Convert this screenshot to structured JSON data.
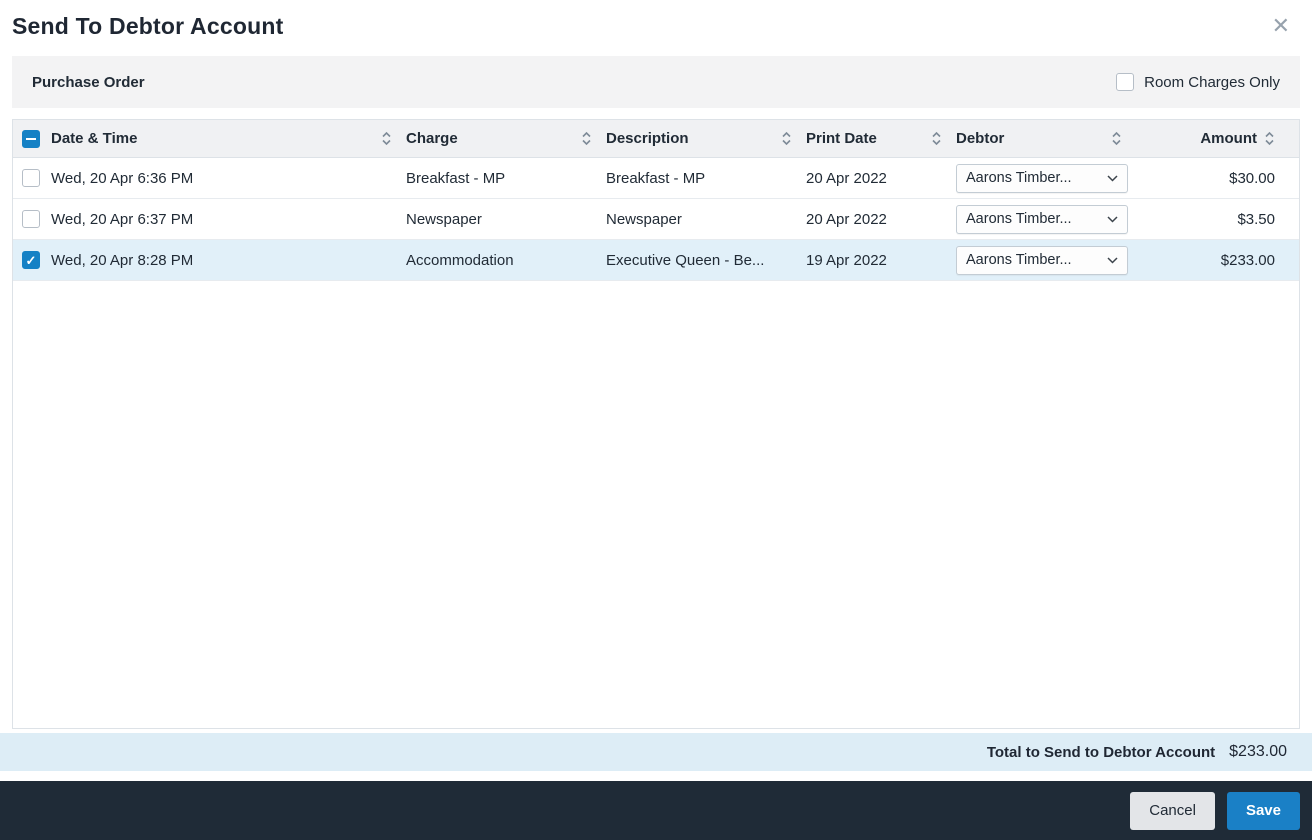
{
  "modal": {
    "title": "Send To Debtor Account"
  },
  "toolbar": {
    "left_label": "Purchase Order",
    "room_charges_label": "Room Charges Only",
    "room_charges_checked": false
  },
  "table": {
    "select_all_state": "indeterminate",
    "columns": [
      "Date & Time",
      "Charge",
      "Description",
      "Print Date",
      "Debtor",
      "Amount"
    ],
    "rows": [
      {
        "checked": false,
        "selected": false,
        "datetime": "Wed, 20 Apr 6:36 PM",
        "charge": "Breakfast - MP",
        "description": "Breakfast - MP",
        "print_date": "20 Apr 2022",
        "debtor": "Aarons Timber...",
        "amount": "$30.00"
      },
      {
        "checked": false,
        "selected": false,
        "datetime": "Wed, 20 Apr 6:37 PM",
        "charge": "Newspaper",
        "description": "Newspaper",
        "print_date": "20 Apr 2022",
        "debtor": "Aarons Timber...",
        "amount": "$3.50"
      },
      {
        "checked": true,
        "selected": true,
        "datetime": "Wed, 20 Apr 8:28 PM",
        "charge": "Accommodation",
        "description": "Executive Queen - Be...",
        "print_date": "19 Apr 2022",
        "debtor": "Aarons Timber...",
        "amount": "$233.00"
      }
    ]
  },
  "footer": {
    "total_label": "Total to Send to Debtor Account",
    "total_amount": "$233.00"
  },
  "actions": {
    "cancel_label": "Cancel",
    "save_label": "Save"
  },
  "colors": {
    "accent_blue": "#1581c5",
    "save_button_blue": "#1a80c6",
    "selected_row_bg": "#e1f0f9",
    "total_bar_bg": "#ddedf6",
    "action_bar_bg": "#1f2b37",
    "subbar_bg": "#f3f3f4"
  }
}
